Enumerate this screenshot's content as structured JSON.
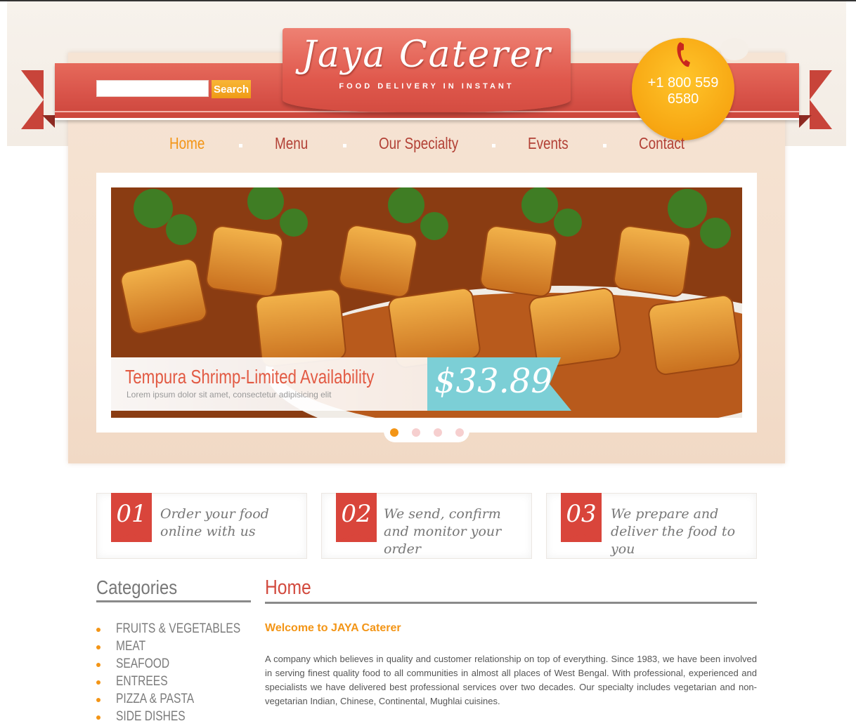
{
  "brand": {
    "title": "Jaya Caterer",
    "tagline": "FOOD DELIVERY IN INSTANT",
    "phone": "+1 800 559 6580"
  },
  "search": {
    "placeholder": "",
    "button_label": "Search"
  },
  "nav": {
    "items": [
      {
        "label": "Home",
        "active": true
      },
      {
        "label": "Menu",
        "active": false
      },
      {
        "label": "Our Specialty",
        "active": false
      },
      {
        "label": "Events",
        "active": false
      },
      {
        "label": "Contact",
        "active": false
      }
    ]
  },
  "slider": {
    "caption_title": "Tempura Shrimp-Limited Availability",
    "caption_subtitle": "Lorem ipsum dolor sit amet, consectetur adipisicing elit",
    "price": "$33.89",
    "dot_count": 4,
    "active_dot": 1
  },
  "steps": [
    {
      "number": "01",
      "text": "Order your food online with us"
    },
    {
      "number": "02",
      "text": "We send, confirm and monitor your order"
    },
    {
      "number": "03",
      "text": "We prepare and deliver the food to you"
    }
  ],
  "sidebar": {
    "heading": "Categories",
    "items": [
      "FRUITS & VEGETABLES",
      "MEAT",
      "SEAFOOD",
      "ENTREES",
      "PIZZA & PASTA",
      "SIDE DISHES"
    ]
  },
  "main": {
    "heading": "Home",
    "welcome": "Welcome to JAYA Caterer",
    "intro": "A company which believes in quality and customer relationship on top of everything. Since 1983, we have been involved in serving finest quality food to all communities in almost all places of West Bengal. With professional, experienced and specialists we have delivered best professional services over two decades. Our specialty includes vegetarian and non-vegetarian Indian, Chinese, Continental, Mughlai cuisines."
  },
  "colors": {
    "brand_red": "#d9544a",
    "accent_orange": "#f39516",
    "price_teal": "#7ccfd6"
  },
  "icons": {
    "phone": "phone-icon"
  }
}
